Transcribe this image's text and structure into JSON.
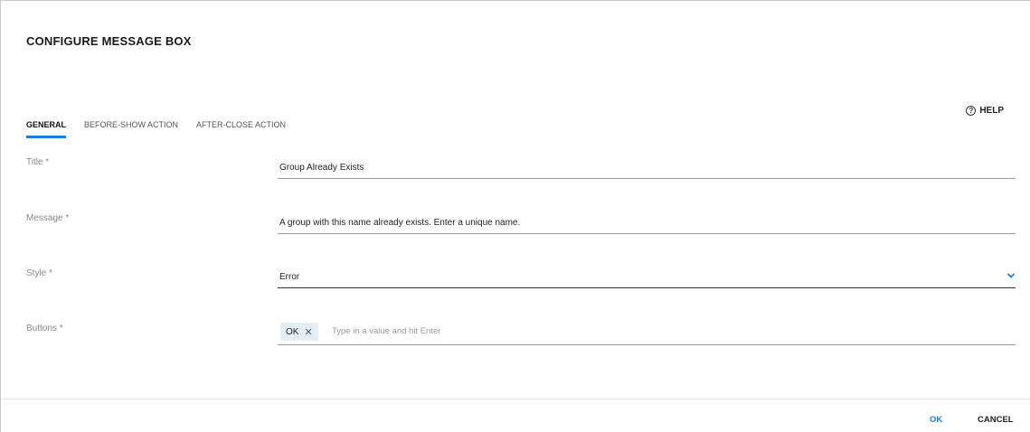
{
  "dialog": {
    "title": "CONFIGURE MESSAGE BOX",
    "help_label": "HELP",
    "help_icon": "?"
  },
  "tabs": [
    {
      "label": "GENERAL",
      "active": true
    },
    {
      "label": "BEFORE-SHOW ACTION",
      "active": false
    },
    {
      "label": "AFTER-CLOSE ACTION",
      "active": false
    }
  ],
  "form": {
    "title_label": "Title *",
    "title_value": "Group Already Exists",
    "message_label": "Message *",
    "message_value": "A group with this name already exists. Enter a unique name.",
    "style_label": "Style *",
    "style_value": "Error",
    "buttons_label": "Buttons *",
    "buttons_chip": "OK",
    "buttons_chip_remove": "✕",
    "buttons_placeholder": "Type in a value and hit Enter"
  },
  "footer": {
    "ok_label": "OK",
    "cancel_label": "CANCEL"
  },
  "colors": {
    "accent": "#1a7fd6",
    "chip_bg": "#e4eef7"
  }
}
